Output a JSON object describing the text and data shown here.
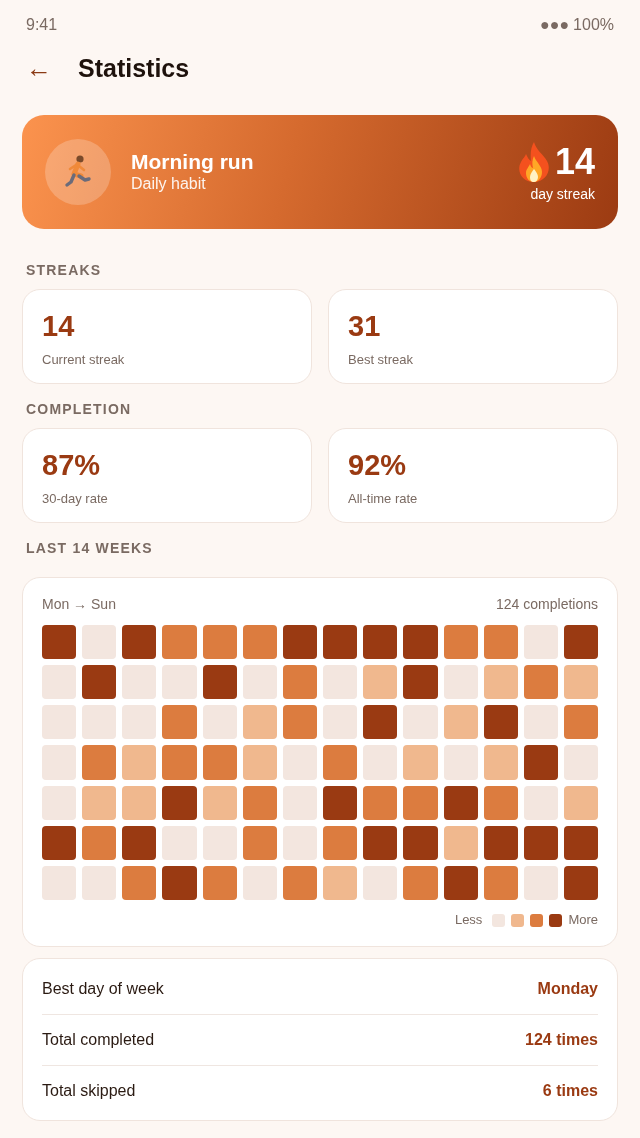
{
  "status_bar": {
    "time": "9:41",
    "signal": "●●●",
    "battery": "100%"
  },
  "header": {
    "back": "←",
    "title": "Statistics"
  },
  "habit": {
    "name": "Morning run",
    "frequency": "Daily habit",
    "streak": "14",
    "streak_label": "day streak"
  },
  "sections": [
    {
      "title": "STREAKS",
      "cards": [
        {
          "value": "14",
          "label": "Current streak"
        },
        {
          "value": "31",
          "label": "Best streak"
        }
      ]
    },
    {
      "title": "COMPLETION",
      "cards": [
        {
          "value": "87%",
          "label": "30-day rate"
        },
        {
          "value": "92%",
          "label": "All-time rate"
        }
      ]
    }
  ],
  "heatmap": {
    "title": "LAST 14 WEEKS",
    "range": "Mon → Sun",
    "total": "124 completions",
    "rows": [
      {
        "cells": [
          {
            "color": "#9a3a12"
          },
          {
            "color": "#f3e6df"
          },
          {
            "color": "#9a3a12"
          },
          {
            "color": "#dc7c3f"
          },
          {
            "color": "#dc7c3f"
          },
          {
            "color": "#dc7c3f"
          },
          {
            "color": "#9a3a12"
          },
          {
            "color": "#9a3a12"
          },
          {
            "color": "#9a3a12"
          },
          {
            "color": "#9a3a12"
          },
          {
            "color": "#dc7c3f"
          },
          {
            "color": "#dc7c3f"
          },
          {
            "color": "#f3e6df"
          },
          {
            "color": "#9a3a12"
          }
        ]
      },
      {
        "cells": [
          {
            "color": "#f3e6df"
          },
          {
            "color": "#9a3a12"
          },
          {
            "color": "#f3e6df"
          },
          {
            "color": "#f3e6df"
          },
          {
            "color": "#9a3a12"
          },
          {
            "color": "#f3e6df"
          },
          {
            "color": "#dc7c3f"
          },
          {
            "color": "#f3e6df"
          },
          {
            "color": "#f0b88e"
          },
          {
            "color": "#9a3a12"
          },
          {
            "color": "#f3e6df"
          },
          {
            "color": "#f0b88e"
          },
          {
            "color": "#dc7c3f"
          },
          {
            "color": "#f0b88e"
          }
        ]
      },
      {
        "cells": [
          {
            "color": "#f3e6df"
          },
          {
            "color": "#f3e6df"
          },
          {
            "color": "#f3e6df"
          },
          {
            "color": "#dc7c3f"
          },
          {
            "color": "#f3e6df"
          },
          {
            "color": "#f0b88e"
          },
          {
            "color": "#dc7c3f"
          },
          {
            "color": "#f3e6df"
          },
          {
            "color": "#9a3a12"
          },
          {
            "color": "#f3e6df"
          },
          {
            "color": "#f0b88e"
          },
          {
            "color": "#9a3a12"
          },
          {
            "color": "#f3e6df"
          },
          {
            "color": "#dc7c3f"
          }
        ]
      },
      {
        "cells": [
          {
            "color": "#f3e6df"
          },
          {
            "color": "#dc7c3f"
          },
          {
            "color": "#f0b88e"
          },
          {
            "color": "#dc7c3f"
          },
          {
            "color": "#dc7c3f"
          },
          {
            "color": "#f0b88e"
          },
          {
            "color": "#f3e6df"
          },
          {
            "color": "#dc7c3f"
          },
          {
            "color": "#f3e6df"
          },
          {
            "color": "#f0b88e"
          },
          {
            "color": "#f3e6df"
          },
          {
            "color": "#f0b88e"
          },
          {
            "color": "#9a3a12"
          },
          {
            "color": "#f3e6df"
          }
        ]
      },
      {
        "cells": [
          {
            "color": "#f3e6df"
          },
          {
            "color": "#f0b88e"
          },
          {
            "color": "#f0b88e"
          },
          {
            "color": "#9a3a12"
          },
          {
            "color": "#f0b88e"
          },
          {
            "color": "#dc7c3f"
          },
          {
            "color": "#f3e6df"
          },
          {
            "color": "#9a3a12"
          },
          {
            "color": "#dc7c3f"
          },
          {
            "color": "#dc7c3f"
          },
          {
            "color": "#9a3a12"
          },
          {
            "color": "#dc7c3f"
          },
          {
            "color": "#f3e6df"
          },
          {
            "color": "#f0b88e"
          }
        ]
      },
      {
        "cells": [
          {
            "color": "#9a3a12"
          },
          {
            "color": "#dc7c3f"
          },
          {
            "color": "#9a3a12"
          },
          {
            "color": "#f3e6df"
          },
          {
            "color": "#f3e6df"
          },
          {
            "color": "#dc7c3f"
          },
          {
            "color": "#f3e6df"
          },
          {
            "color": "#dc7c3f"
          },
          {
            "color": "#9a3a12"
          },
          {
            "color": "#9a3a12"
          },
          {
            "color": "#f0b88e"
          },
          {
            "color": "#9a3a12"
          },
          {
            "color": "#9a3a12"
          },
          {
            "color": "#9a3a12"
          }
        ]
      },
      {
        "cells": [
          {
            "color": "#f3e6df"
          },
          {
            "color": "#f3e6df"
          },
          {
            "color": "#dc7c3f"
          },
          {
            "color": "#9a3a12"
          },
          {
            "color": "#dc7c3f"
          },
          {
            "color": "#f3e6df"
          },
          {
            "color": "#dc7c3f"
          },
          {
            "color": "#f0b88e"
          },
          {
            "color": "#f3e6df"
          },
          {
            "color": "#dc7c3f"
          },
          {
            "color": "#9a3a12"
          },
          {
            "color": "#dc7c3f"
          },
          {
            "color": "#f3e6df"
          },
          {
            "color": "#9a3a12"
          }
        ]
      }
    ],
    "legend": {
      "less": "Less",
      "more": "More",
      "swatches": [
        {
          "color": "#f3e6df"
        },
        {
          "color": "#f0b88e"
        },
        {
          "color": "#dc7c3f"
        },
        {
          "color": "#9a3a12"
        }
      ]
    }
  },
  "summary": [
    {
      "label": "Best day of week",
      "value": "Monday"
    },
    {
      "label": "Total completed",
      "value": "124 times"
    },
    {
      "label": "Total skipped",
      "value": "6 times"
    }
  ]
}
